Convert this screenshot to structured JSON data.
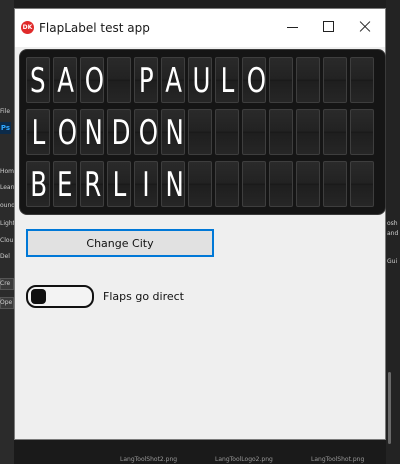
{
  "window": {
    "title": "FlapLabel test app",
    "app_icon_text": "DK",
    "app_icon_color": "#e02a2a"
  },
  "flap_board": {
    "columns": 13,
    "rows": [
      "SAO PAULO",
      "LONDON",
      "BERLIN"
    ]
  },
  "controls": {
    "change_city_label": "Change City",
    "flaps_toggle_label": "Flaps go direct",
    "flaps_toggle_on": false
  },
  "background": {
    "left_labels": [
      "File",
      "Hom",
      "Learn",
      "ound",
      "Light",
      "Clou",
      "Del",
      "Cre",
      "Ope"
    ],
    "ps_icon": "Ps",
    "right_labels": [
      "osh",
      "and",
      "Gui"
    ],
    "files": [
      "LangToolShot2.png",
      "LangToolLogo2.png",
      "LangToolShot.png"
    ]
  },
  "colors": {
    "accent": "#0078d7",
    "board_background": "#151515",
    "window_background": "#efefef"
  }
}
